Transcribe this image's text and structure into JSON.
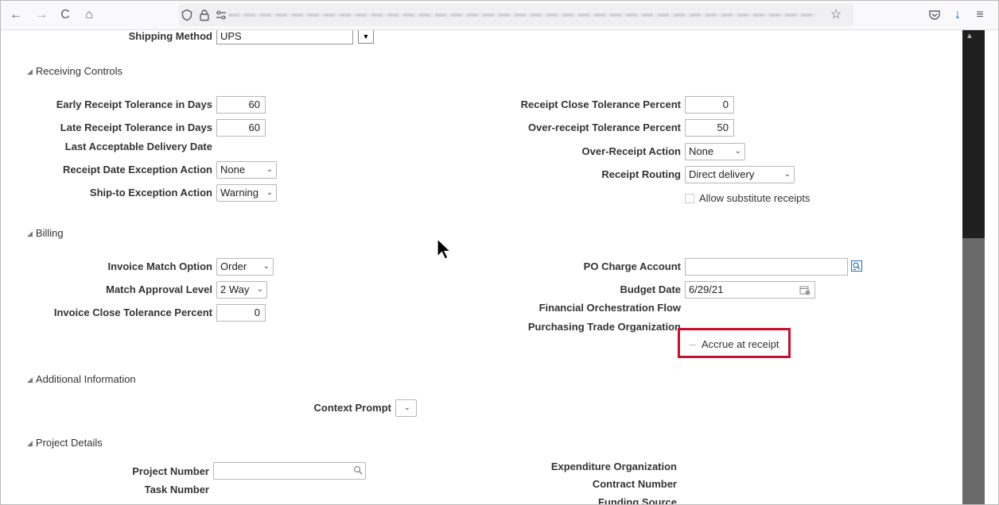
{
  "browser": {
    "nav": {
      "back": "←",
      "forward": "→",
      "reload": "C",
      "home": "⌂"
    },
    "url_icons": {
      "shield": "shield-icon",
      "lock": "lock-icon",
      "permissions": "permissions-icon"
    },
    "right_icons": {
      "bookmark": "☆",
      "pocket": "pocket-icon",
      "downloads": "↓",
      "menu": "≡"
    }
  },
  "shipping": {
    "label": "Shipping Method",
    "value": "UPS"
  },
  "receiving": {
    "title": "Receiving Controls",
    "early_label": "Early Receipt Tolerance in Days",
    "early_value": "60",
    "late_label": "Late Receipt Tolerance in Days",
    "late_value": "60",
    "last_date_label": "Last Acceptable Delivery Date",
    "date_exc_label": "Receipt Date Exception Action",
    "date_exc_value": "None",
    "shipto_label": "Ship-to Exception Action",
    "shipto_value": "Warning",
    "close_label": "Receipt Close Tolerance Percent",
    "close_value": "0",
    "over_pct_label": "Over-receipt Tolerance Percent",
    "over_pct_value": "50",
    "over_action_label": "Over-Receipt Action",
    "over_action_value": "None",
    "routing_label": "Receipt Routing",
    "routing_value": "Direct delivery",
    "substitute_label": "Allow substitute receipts"
  },
  "billing": {
    "title": "Billing",
    "match_option_label": "Invoice Match Option",
    "match_option_value": "Order",
    "match_level_label": "Match Approval Level",
    "match_level_value": "2 Way",
    "inv_close_label": "Invoice Close Tolerance Percent",
    "inv_close_value": "0",
    "charge_label": "PO Charge Account",
    "charge_value": "",
    "budget_label": "Budget Date",
    "budget_value": "6/29/21",
    "fin_flow_label": "Financial Orchestration Flow",
    "trade_org_label": "Purchasing Trade Organization",
    "accrue_label": "Accrue at receipt"
  },
  "additional": {
    "title": "Additional Information",
    "context_label": "Context Prompt"
  },
  "project": {
    "title": "Project Details",
    "number_label": "Project Number",
    "task_label": "Task Number",
    "exp_org_label": "Expenditure Organization",
    "contract_label": "Contract Number",
    "funding_label": "Funding Source"
  },
  "colors": {
    "highlight": "#c8102e",
    "downloads": "#0060df"
  }
}
